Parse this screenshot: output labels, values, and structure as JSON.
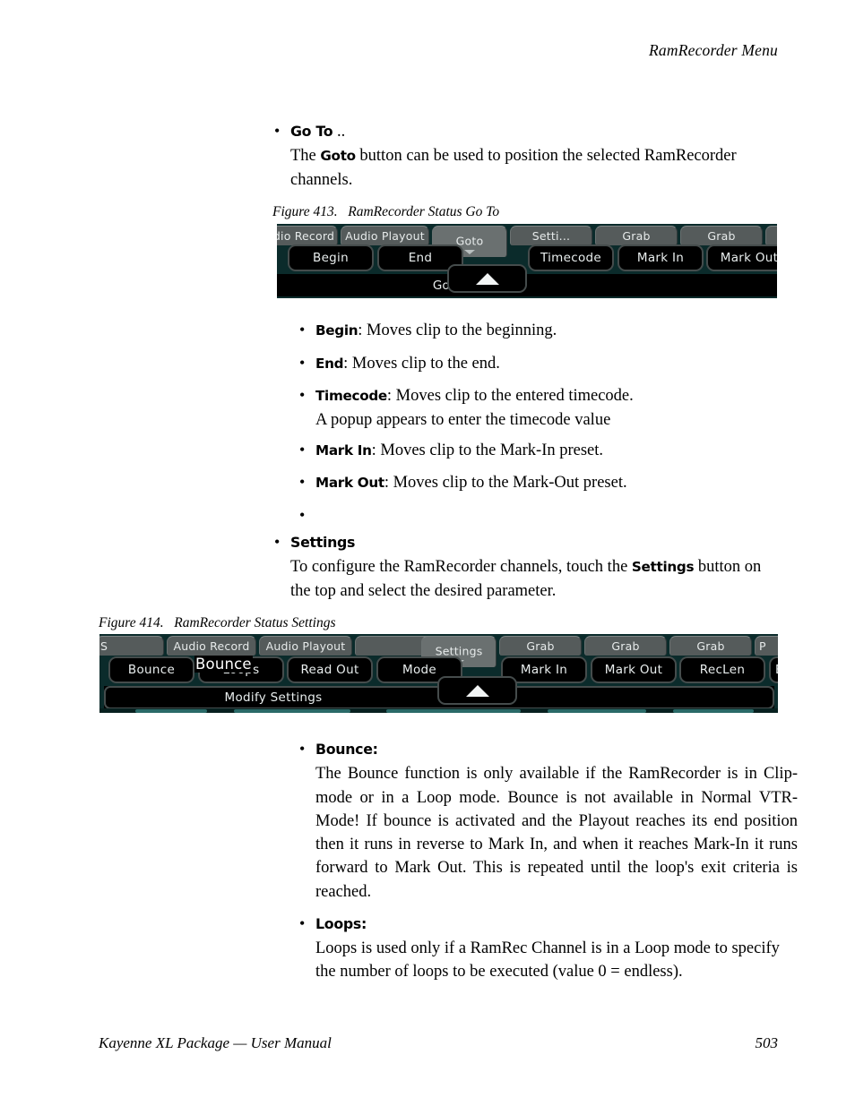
{
  "page": {
    "running_head": "RamRecorder Menu",
    "footer_left": "Kayenne XL Package  —  User Manual",
    "page_number": "503"
  },
  "colors": {
    "panel_background": "#0b2b2b",
    "button_face": "#000000",
    "button_border": "#454c4c",
    "tab_face": "#555b5b",
    "tab_selected": "#6a7070",
    "text": "#e9eeee"
  },
  "sections": {
    "goto": {
      "bullet": "•",
      "lead": "Go To",
      "lead_suffix": " ..",
      "body_prefix": "The ",
      "body_bold": "Goto",
      "body_suffix": " button can be used to position the selected RamRecorder channels."
    },
    "goto_items": [
      {
        "bullet": "•",
        "lead": "Begin",
        "text": ": Moves clip to the beginning."
      },
      {
        "bullet": "•",
        "lead": "End",
        "text": ": Moves clip to the end."
      },
      {
        "bullet": "•",
        "lead": "Timecode",
        "text": ": Moves clip to the entered timecode.",
        "text2": "A popup appears to enter the timecode value"
      },
      {
        "bullet": "•",
        "lead": "Mark In",
        "text": ": Moves clip to the Mark-In preset."
      },
      {
        "bullet": "•",
        "lead": "Mark Out",
        "text": ": Moves clip to the Mark-Out preset."
      },
      {
        "bullet": "•",
        "lead": "",
        "text": ""
      }
    ],
    "settings": {
      "bullet": "•",
      "lead": "Settings",
      "body_prefix": "To configure the RamRecorder channels, touch the ",
      "body_bold": "Settings",
      "body_suffix": " button on the top and select the desired parameter."
    },
    "settings_items": [
      {
        "bullet": "•",
        "lead": "Bounce:",
        "text": "The Bounce function is only available if the RamRecorder is in Clip-mode or in a Loop mode. Bounce is not available in Normal VTR-Mode! If bounce is activated and the Playout reaches its end position then it runs in reverse to Mark In, and when it reaches Mark-In it runs forward to Mark Out. This is repeated until the loop's exit criteria is reached."
      },
      {
        "bullet": "•",
        "lead": "Loops:",
        "text": "Loops is used only if a RamRec Channel is in a Loop mode to specify the number of loops to be executed (value 0 = endless)."
      }
    ]
  },
  "figures": [
    {
      "caption_number": "Figure 413.",
      "caption_title": "RamRecorder Status Go To",
      "tabs": [
        {
          "label": "dio Record",
          "selected": false
        },
        {
          "label": "Audio Playout",
          "selected": false
        },
        {
          "label": "Goto",
          "selected": true
        },
        {
          "label": "Setti...",
          "selected": false
        },
        {
          "label": "Grab",
          "selected": false
        },
        {
          "label": "Grab",
          "selected": false
        },
        {
          "label": "",
          "selected": false
        }
      ],
      "buttons": [
        {
          "label": "Begin"
        },
        {
          "label": "End"
        },
        {
          "label": "Timecode"
        },
        {
          "label": "Mark In"
        },
        {
          "label": "Mark Out"
        }
      ],
      "bottom_label": "Goto",
      "popup_arrow_icon": "up-triangle-icon"
    },
    {
      "caption_number": "Figure 414.",
      "caption_title": "RamRecorder Status Settings",
      "tabs": [
        {
          "label": "S",
          "selected": false
        },
        {
          "label": "Audio Record",
          "selected": false
        },
        {
          "label": "Audio Playout",
          "selected": false
        },
        {
          "label": "",
          "selected": false
        },
        {
          "label": "Settings",
          "selected": true
        },
        {
          "label": "Grab",
          "selected": false
        },
        {
          "label": "Grab",
          "selected": false
        },
        {
          "label": "Grab",
          "selected": false
        },
        {
          "label": "P",
          "selected": false
        }
      ],
      "buttons": [
        {
          "label": "Bounce"
        },
        {
          "label": "Loops"
        },
        {
          "label": "Read Out"
        },
        {
          "label": "Mode"
        },
        {
          "label": "Mark In"
        },
        {
          "label": "Mark Out"
        },
        {
          "label": "RecLen"
        },
        {
          "label": "B"
        }
      ],
      "float_label": "Bounce",
      "bottom_label": "Modify Settings",
      "popup_arrow_icon": "up-triangle-icon"
    }
  ]
}
